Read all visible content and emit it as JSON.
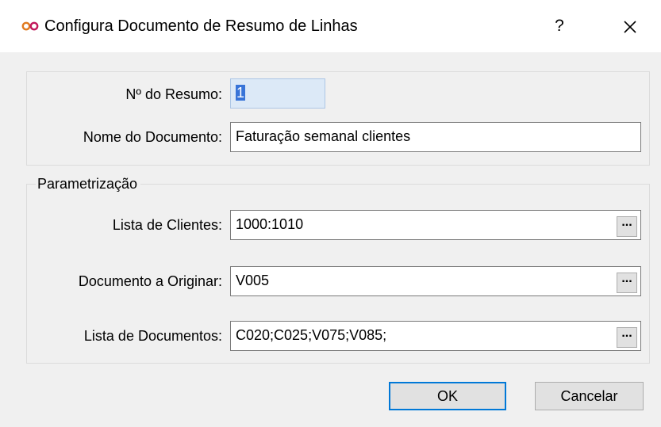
{
  "window": {
    "title": "Configura Documento de Resumo de Linhas",
    "help_label": "?",
    "icon": "infinity-logo-icon",
    "accent_color": "#d2691e"
  },
  "form": {
    "resumo_number": {
      "label": "Nº do Resumo:",
      "value": "1"
    },
    "document_name": {
      "label": "Nome do Documento:",
      "value": "Faturação semanal clientes"
    },
    "parametrizacao": {
      "legend": "Parametrização",
      "client_list": {
        "label": "Lista de Clientes:",
        "value": "1000:1010",
        "browse_label": "..."
      },
      "origin_document": {
        "label": "Documento a Originar:",
        "value": "V005",
        "browse_label": "..."
      },
      "document_list": {
        "label": "Lista de Documentos:",
        "value": "C020;C025;V075;V085;",
        "browse_label": "..."
      }
    }
  },
  "buttons": {
    "ok_label": "OK",
    "cancel_label": "Cancelar"
  }
}
